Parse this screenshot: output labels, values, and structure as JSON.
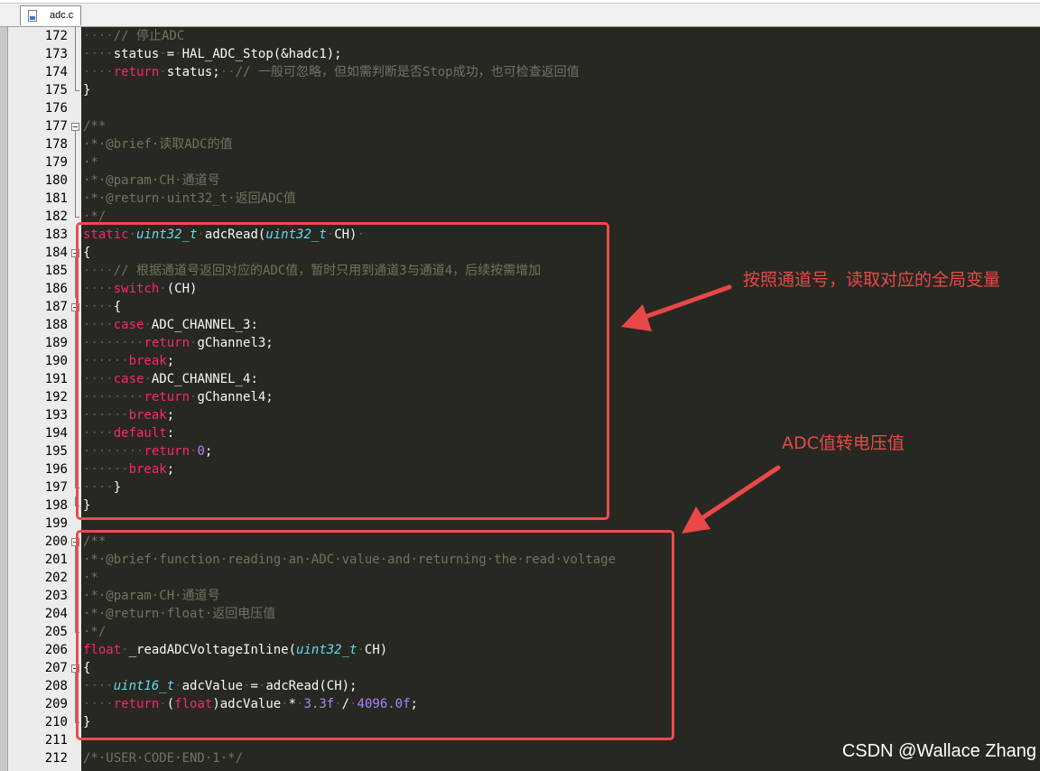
{
  "tab": {
    "filename": "adc.c",
    "icon": "c-file-icon"
  },
  "colors": {
    "editor_bg": "#272822",
    "keyword": "#f92672",
    "type": "#66d9ef",
    "comment": "#75715e",
    "number": "#ae81ff",
    "annotation": "#e84848"
  },
  "lines": [
    {
      "n": "172",
      "fold": "line",
      "tokens": [
        [
          "ws",
          "····"
        ],
        [
          "cm",
          "// 停止ADC"
        ]
      ]
    },
    {
      "n": "173",
      "fold": "line",
      "tokens": [
        [
          "ws",
          "····"
        ],
        [
          "p",
          "status"
        ],
        [
          "ws",
          "·"
        ],
        [
          "p",
          "="
        ],
        [
          "ws",
          "·"
        ],
        [
          "p",
          "HAL_ADC_Stop(&hadc1);"
        ]
      ]
    },
    {
      "n": "174",
      "fold": "line",
      "tokens": [
        [
          "ws",
          "····"
        ],
        [
          "kw",
          "return"
        ],
        [
          "ws",
          "·"
        ],
        [
          "p",
          "status;"
        ],
        [
          "ws",
          "··"
        ],
        [
          "cm",
          "// 一般可忽略，但如需判断是否Stop成功，也可检查返回值"
        ]
      ]
    },
    {
      "n": "175",
      "fold": "end",
      "tokens": [
        [
          "p",
          "}"
        ]
      ]
    },
    {
      "n": "176",
      "fold": "",
      "tokens": []
    },
    {
      "n": "177",
      "fold": "start",
      "tokens": [
        [
          "cm",
          "/**"
        ]
      ]
    },
    {
      "n": "178",
      "fold": "line",
      "tokens": [
        [
          "cm",
          "·*·@brief·读取ADC的值"
        ]
      ]
    },
    {
      "n": "179",
      "fold": "line",
      "tokens": [
        [
          "cm",
          "·*"
        ]
      ]
    },
    {
      "n": "180",
      "fold": "line",
      "tokens": [
        [
          "cm",
          "·*·@param·CH·通道号"
        ]
      ]
    },
    {
      "n": "181",
      "fold": "line",
      "tokens": [
        [
          "cm",
          "·*·@return·uint32_t·返回ADC值"
        ]
      ]
    },
    {
      "n": "182",
      "fold": "end",
      "tokens": [
        [
          "cm",
          "·*/"
        ]
      ]
    },
    {
      "n": "183",
      "fold": "",
      "tokens": [
        [
          "kw",
          "static"
        ],
        [
          "ws",
          "·"
        ],
        [
          "ty",
          "uint32_t"
        ],
        [
          "ws",
          "·"
        ],
        [
          "p",
          "adcRead("
        ],
        [
          "ty",
          "uint32_t"
        ],
        [
          "ws",
          "·"
        ],
        [
          "p",
          "CH)"
        ],
        [
          "ws",
          "·"
        ]
      ]
    },
    {
      "n": "184",
      "fold": "start",
      "tokens": [
        [
          "p",
          "{"
        ]
      ]
    },
    {
      "n": "185",
      "fold": "line",
      "tokens": [
        [
          "ws",
          "····"
        ],
        [
          "cm",
          "// 根据通道号返回对应的ADC值，暂时只用到通道3与通道4，后续按需增加"
        ]
      ]
    },
    {
      "n": "186",
      "fold": "line",
      "tokens": [
        [
          "ws",
          "····"
        ],
        [
          "kw",
          "switch"
        ],
        [
          "ws",
          "·"
        ],
        [
          "p",
          "(CH)"
        ]
      ]
    },
    {
      "n": "187",
      "fold": "start",
      "tokens": [
        [
          "ws",
          "····"
        ],
        [
          "p",
          "{"
        ]
      ]
    },
    {
      "n": "188",
      "fold": "line",
      "tokens": [
        [
          "ws",
          "····"
        ],
        [
          "kw",
          "case"
        ],
        [
          "ws",
          "·"
        ],
        [
          "p",
          "ADC_CHANNEL_3:"
        ]
      ]
    },
    {
      "n": "189",
      "fold": "line",
      "tokens": [
        [
          "ws",
          "········"
        ],
        [
          "kw",
          "return"
        ],
        [
          "ws",
          "·"
        ],
        [
          "p",
          "gChannel3;"
        ]
      ]
    },
    {
      "n": "190",
      "fold": "line",
      "tokens": [
        [
          "ws",
          "······"
        ],
        [
          "kw",
          "break"
        ],
        [
          "p",
          ";"
        ]
      ]
    },
    {
      "n": "191",
      "fold": "line",
      "tokens": [
        [
          "ws",
          "····"
        ],
        [
          "kw",
          "case"
        ],
        [
          "ws",
          "·"
        ],
        [
          "p",
          "ADC_CHANNEL_4:"
        ]
      ]
    },
    {
      "n": "192",
      "fold": "line",
      "tokens": [
        [
          "ws",
          "········"
        ],
        [
          "kw",
          "return"
        ],
        [
          "ws",
          "·"
        ],
        [
          "p",
          "gChannel4;"
        ]
      ]
    },
    {
      "n": "193",
      "fold": "line",
      "tokens": [
        [
          "ws",
          "······"
        ],
        [
          "kw",
          "break"
        ],
        [
          "p",
          ";"
        ]
      ]
    },
    {
      "n": "194",
      "fold": "line",
      "tokens": [
        [
          "ws",
          "····"
        ],
        [
          "kw",
          "default"
        ],
        [
          "p",
          ":"
        ]
      ]
    },
    {
      "n": "195",
      "fold": "line",
      "tokens": [
        [
          "ws",
          "········"
        ],
        [
          "kw",
          "return"
        ],
        [
          "ws",
          "·"
        ],
        [
          "num",
          "0"
        ],
        [
          "p",
          ";"
        ]
      ]
    },
    {
      "n": "196",
      "fold": "line",
      "tokens": [
        [
          "ws",
          "······"
        ],
        [
          "kw",
          "break"
        ],
        [
          "p",
          ";"
        ]
      ]
    },
    {
      "n": "197",
      "fold": "end",
      "tokens": [
        [
          "ws",
          "····"
        ],
        [
          "p",
          "}"
        ]
      ]
    },
    {
      "n": "198",
      "fold": "end",
      "tokens": [
        [
          "p",
          "}"
        ]
      ]
    },
    {
      "n": "199",
      "fold": "",
      "tokens": []
    },
    {
      "n": "200",
      "fold": "start",
      "tokens": [
        [
          "cm",
          "/**"
        ]
      ]
    },
    {
      "n": "201",
      "fold": "line",
      "tokens": [
        [
          "cm",
          "·*·@brief·function·reading·an·ADC·value·and·returning·the·read·voltage"
        ]
      ]
    },
    {
      "n": "202",
      "fold": "line",
      "tokens": [
        [
          "cm",
          "·*"
        ]
      ]
    },
    {
      "n": "203",
      "fold": "line",
      "tokens": [
        [
          "cm",
          "·*·@param·CH·通道号"
        ]
      ]
    },
    {
      "n": "204",
      "fold": "line",
      "tokens": [
        [
          "cm",
          "·*·@return·float·返回电压值"
        ]
      ]
    },
    {
      "n": "205",
      "fold": "end",
      "tokens": [
        [
          "cm",
          "·*/"
        ]
      ]
    },
    {
      "n": "206",
      "fold": "",
      "tokens": [
        [
          "kw",
          "float"
        ],
        [
          "ws",
          "·"
        ],
        [
          "p",
          "_readADCVoltageInline("
        ],
        [
          "ty",
          "uint32_t"
        ],
        [
          "ws",
          "·"
        ],
        [
          "p",
          "CH)"
        ]
      ]
    },
    {
      "n": "207",
      "fold": "start",
      "tokens": [
        [
          "p",
          "{"
        ]
      ]
    },
    {
      "n": "208",
      "fold": "line",
      "tokens": [
        [
          "ws",
          "····"
        ],
        [
          "ty",
          "uint16_t"
        ],
        [
          "ws",
          "·"
        ],
        [
          "p",
          "adcValue"
        ],
        [
          "ws",
          "·"
        ],
        [
          "p",
          "="
        ],
        [
          "ws",
          "·"
        ],
        [
          "p",
          "adcRead(CH);"
        ]
      ]
    },
    {
      "n": "209",
      "fold": "line",
      "tokens": [
        [
          "ws",
          "····"
        ],
        [
          "kw",
          "return"
        ],
        [
          "ws",
          "·"
        ],
        [
          "p",
          "("
        ],
        [
          "kw",
          "float"
        ],
        [
          "p",
          ")adcValue"
        ],
        [
          "ws",
          "·"
        ],
        [
          "p",
          "*"
        ],
        [
          "ws",
          "·"
        ],
        [
          "num",
          "3.3f"
        ],
        [
          "ws",
          "·"
        ],
        [
          "p",
          "/"
        ],
        [
          "ws",
          "·"
        ],
        [
          "num",
          "4096.0f"
        ],
        [
          "p",
          ";"
        ]
      ]
    },
    {
      "n": "210",
      "fold": "end",
      "tokens": [
        [
          "p",
          "}"
        ]
      ]
    },
    {
      "n": "211",
      "fold": "",
      "tokens": []
    },
    {
      "n": "212",
      "fold": "",
      "tokens": [
        [
          "cm",
          "/*·USER·CODE·END·1·*/"
        ]
      ]
    }
  ],
  "annotations": {
    "box1_label": "按照通道号，读取对应的全局变量",
    "box2_label": "ADC值转电压值"
  },
  "watermark": "CSDN @Wallace Zhang"
}
